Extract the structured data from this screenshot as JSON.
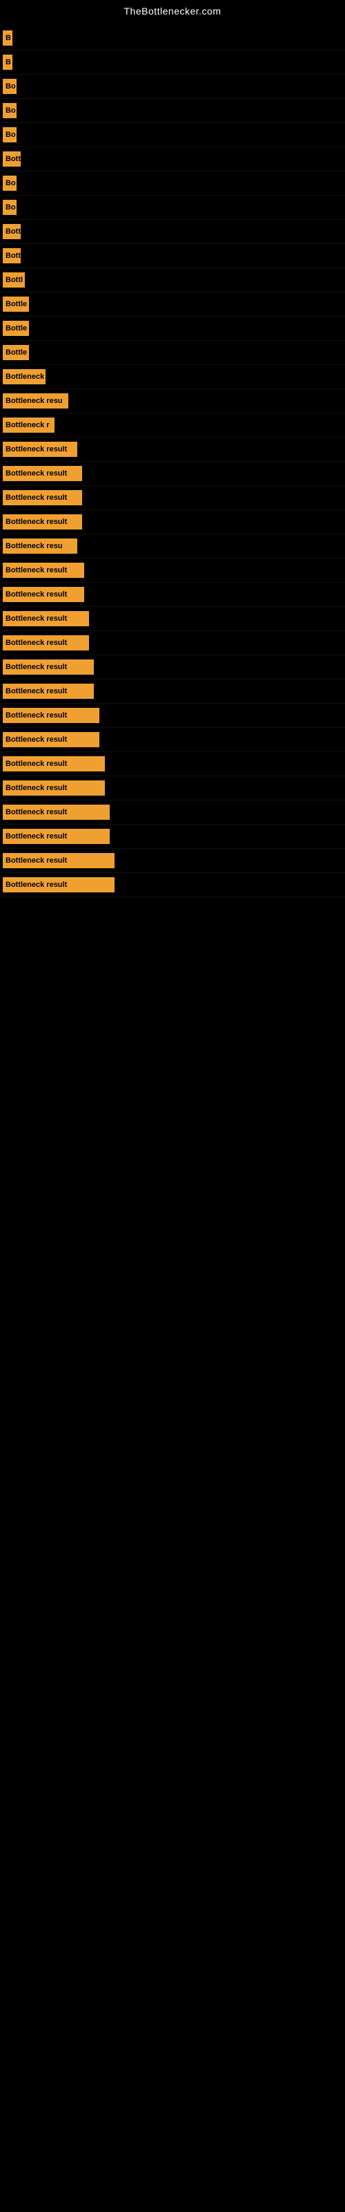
{
  "site": {
    "title": "TheBottlenecker.com"
  },
  "bars": [
    {
      "label": "B",
      "width": 14,
      "text": "B"
    },
    {
      "label": "B",
      "width": 14,
      "text": "B"
    },
    {
      "label": "Bo",
      "width": 20,
      "text": "Bo"
    },
    {
      "label": "Bo",
      "width": 20,
      "text": "Bo"
    },
    {
      "label": "Bo",
      "width": 20,
      "text": "Bo"
    },
    {
      "label": "Bott",
      "width": 26,
      "text": "Bott"
    },
    {
      "label": "Bo",
      "width": 20,
      "text": "Bo"
    },
    {
      "label": "Bo",
      "width": 20,
      "text": "Bo"
    },
    {
      "label": "Bott",
      "width": 26,
      "text": "Bott"
    },
    {
      "label": "Bott",
      "width": 26,
      "text": "Bott"
    },
    {
      "label": "Bottl",
      "width": 32,
      "text": "Bottl"
    },
    {
      "label": "Bottle",
      "width": 38,
      "text": "Bottle"
    },
    {
      "label": "Bottle",
      "width": 38,
      "text": "Bottle"
    },
    {
      "label": "Bottle",
      "width": 38,
      "text": "Bottle"
    },
    {
      "label": "Bottleneck",
      "width": 62,
      "text": "Bottleneck"
    },
    {
      "label": "Bottleneck resu",
      "width": 95,
      "text": "Bottleneck resu"
    },
    {
      "label": "Bottleneck r",
      "width": 75,
      "text": "Bottleneck r"
    },
    {
      "label": "Bottleneck result",
      "width": 108,
      "text": "Bottleneck result"
    },
    {
      "label": "Bottleneck result",
      "width": 115,
      "text": "Bottleneck result"
    },
    {
      "label": "Bottleneck result",
      "width": 115,
      "text": "Bottleneck result"
    },
    {
      "label": "Bottleneck result",
      "width": 115,
      "text": "Bottleneck result"
    },
    {
      "label": "Bottleneck resu",
      "width": 108,
      "text": "Bottleneck resu"
    },
    {
      "label": "Bottleneck result",
      "width": 118,
      "text": "Bottleneck result"
    },
    {
      "label": "Bottleneck result",
      "width": 118,
      "text": "Bottleneck result"
    },
    {
      "label": "Bottleneck result",
      "width": 125,
      "text": "Bottleneck result"
    },
    {
      "label": "Bottleneck result",
      "width": 125,
      "text": "Bottleneck result"
    },
    {
      "label": "Bottleneck result",
      "width": 132,
      "text": "Bottleneck result"
    },
    {
      "label": "Bottleneck result",
      "width": 132,
      "text": "Bottleneck result"
    },
    {
      "label": "Bottleneck result",
      "width": 140,
      "text": "Bottleneck result"
    },
    {
      "label": "Bottleneck result",
      "width": 140,
      "text": "Bottleneck result"
    },
    {
      "label": "Bottleneck result",
      "width": 148,
      "text": "Bottleneck result"
    },
    {
      "label": "Bottleneck result",
      "width": 148,
      "text": "Bottleneck result"
    },
    {
      "label": "Bottleneck result",
      "width": 155,
      "text": "Bottleneck result"
    },
    {
      "label": "Bottleneck result",
      "width": 155,
      "text": "Bottleneck result"
    },
    {
      "label": "Bottleneck result",
      "width": 162,
      "text": "Bottleneck result"
    },
    {
      "label": "Bottleneck result",
      "width": 162,
      "text": "Bottleneck result"
    }
  ]
}
